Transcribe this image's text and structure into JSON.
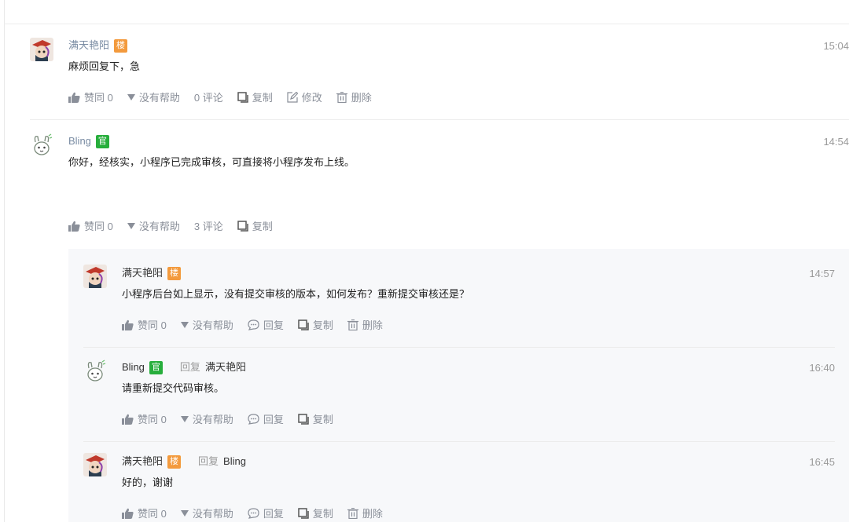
{
  "colors": {
    "lou_badge": "#f39a3d",
    "guan_badge": "#27ae3c",
    "comment_bg": "#f7f8fa"
  },
  "posts": [
    {
      "user": "满天艳阳",
      "badge": "楼",
      "time": "15:04",
      "content": "麻烦回复下，急",
      "actions": {
        "like": "赞同 0",
        "unhelpful": "没有帮助",
        "comments": "0 评论",
        "copy": "复制",
        "edit": "修改",
        "delete": "删除"
      }
    },
    {
      "user": "Bling",
      "badge": "官",
      "time": "14:54",
      "content": "你好，经核实，小程序已完成审核，可直接将小程序发布上线。",
      "actions": {
        "like": "赞同 0",
        "unhelpful": "没有帮助",
        "comments": "3 评论",
        "copy": "复制"
      }
    }
  ],
  "comments": [
    {
      "user": "满天艳阳",
      "badge": "楼",
      "time": "14:57",
      "content": "小程序后台如上显示，没有提交审核的版本，如何发布？重新提交审核还是？",
      "actions": {
        "like": "赞同 0",
        "unhelpful": "没有帮助",
        "reply": "回复",
        "copy": "复制",
        "delete": "删除"
      }
    },
    {
      "user": "Bling",
      "badge": "官",
      "reply_label": "回复",
      "reply_to": "满天艳阳",
      "time": "16:40",
      "content": "请重新提交代码审核。",
      "actions": {
        "like": "赞同 0",
        "unhelpful": "没有帮助",
        "reply": "回复",
        "copy": "复制"
      }
    },
    {
      "user": "满天艳阳",
      "badge": "楼",
      "reply_label": "回复",
      "reply_to": "Bling",
      "time": "16:45",
      "content": "好的，谢谢",
      "actions": {
        "like": "赞同 0",
        "unhelpful": "没有帮助",
        "reply": "回复",
        "copy": "复制",
        "delete": "删除"
      }
    }
  ]
}
